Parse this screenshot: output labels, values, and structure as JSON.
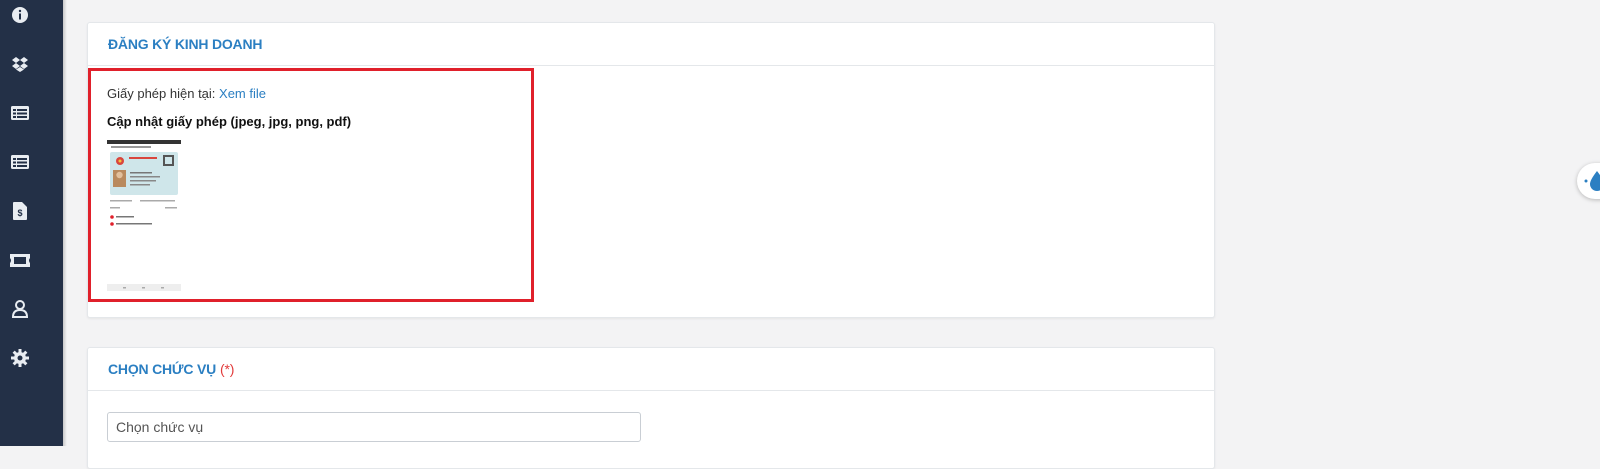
{
  "sidebar": {
    "icons": [
      "info-icon",
      "dropbox-icon",
      "list-icon",
      "list-icon",
      "invoice-icon",
      "ticket-icon",
      "user-icon",
      "gear-icon"
    ]
  },
  "business_registration": {
    "title": "ĐĂNG KÝ KINH DOANH",
    "current_license_label": "Giấy phép hiện tại:",
    "view_file_link": "Xem file",
    "update_title": "Cập nhật giấy phép (jpeg, jpg, png, pdf)"
  },
  "position": {
    "title": "CHỌN CHỨC VỤ",
    "required_mark": "(*)",
    "select_placeholder": "Chọn chức vụ"
  },
  "colors": {
    "sidebar": "#233047",
    "accent": "#2b7fc2",
    "highlight": "#e0202b",
    "required": "#e23b3b"
  }
}
